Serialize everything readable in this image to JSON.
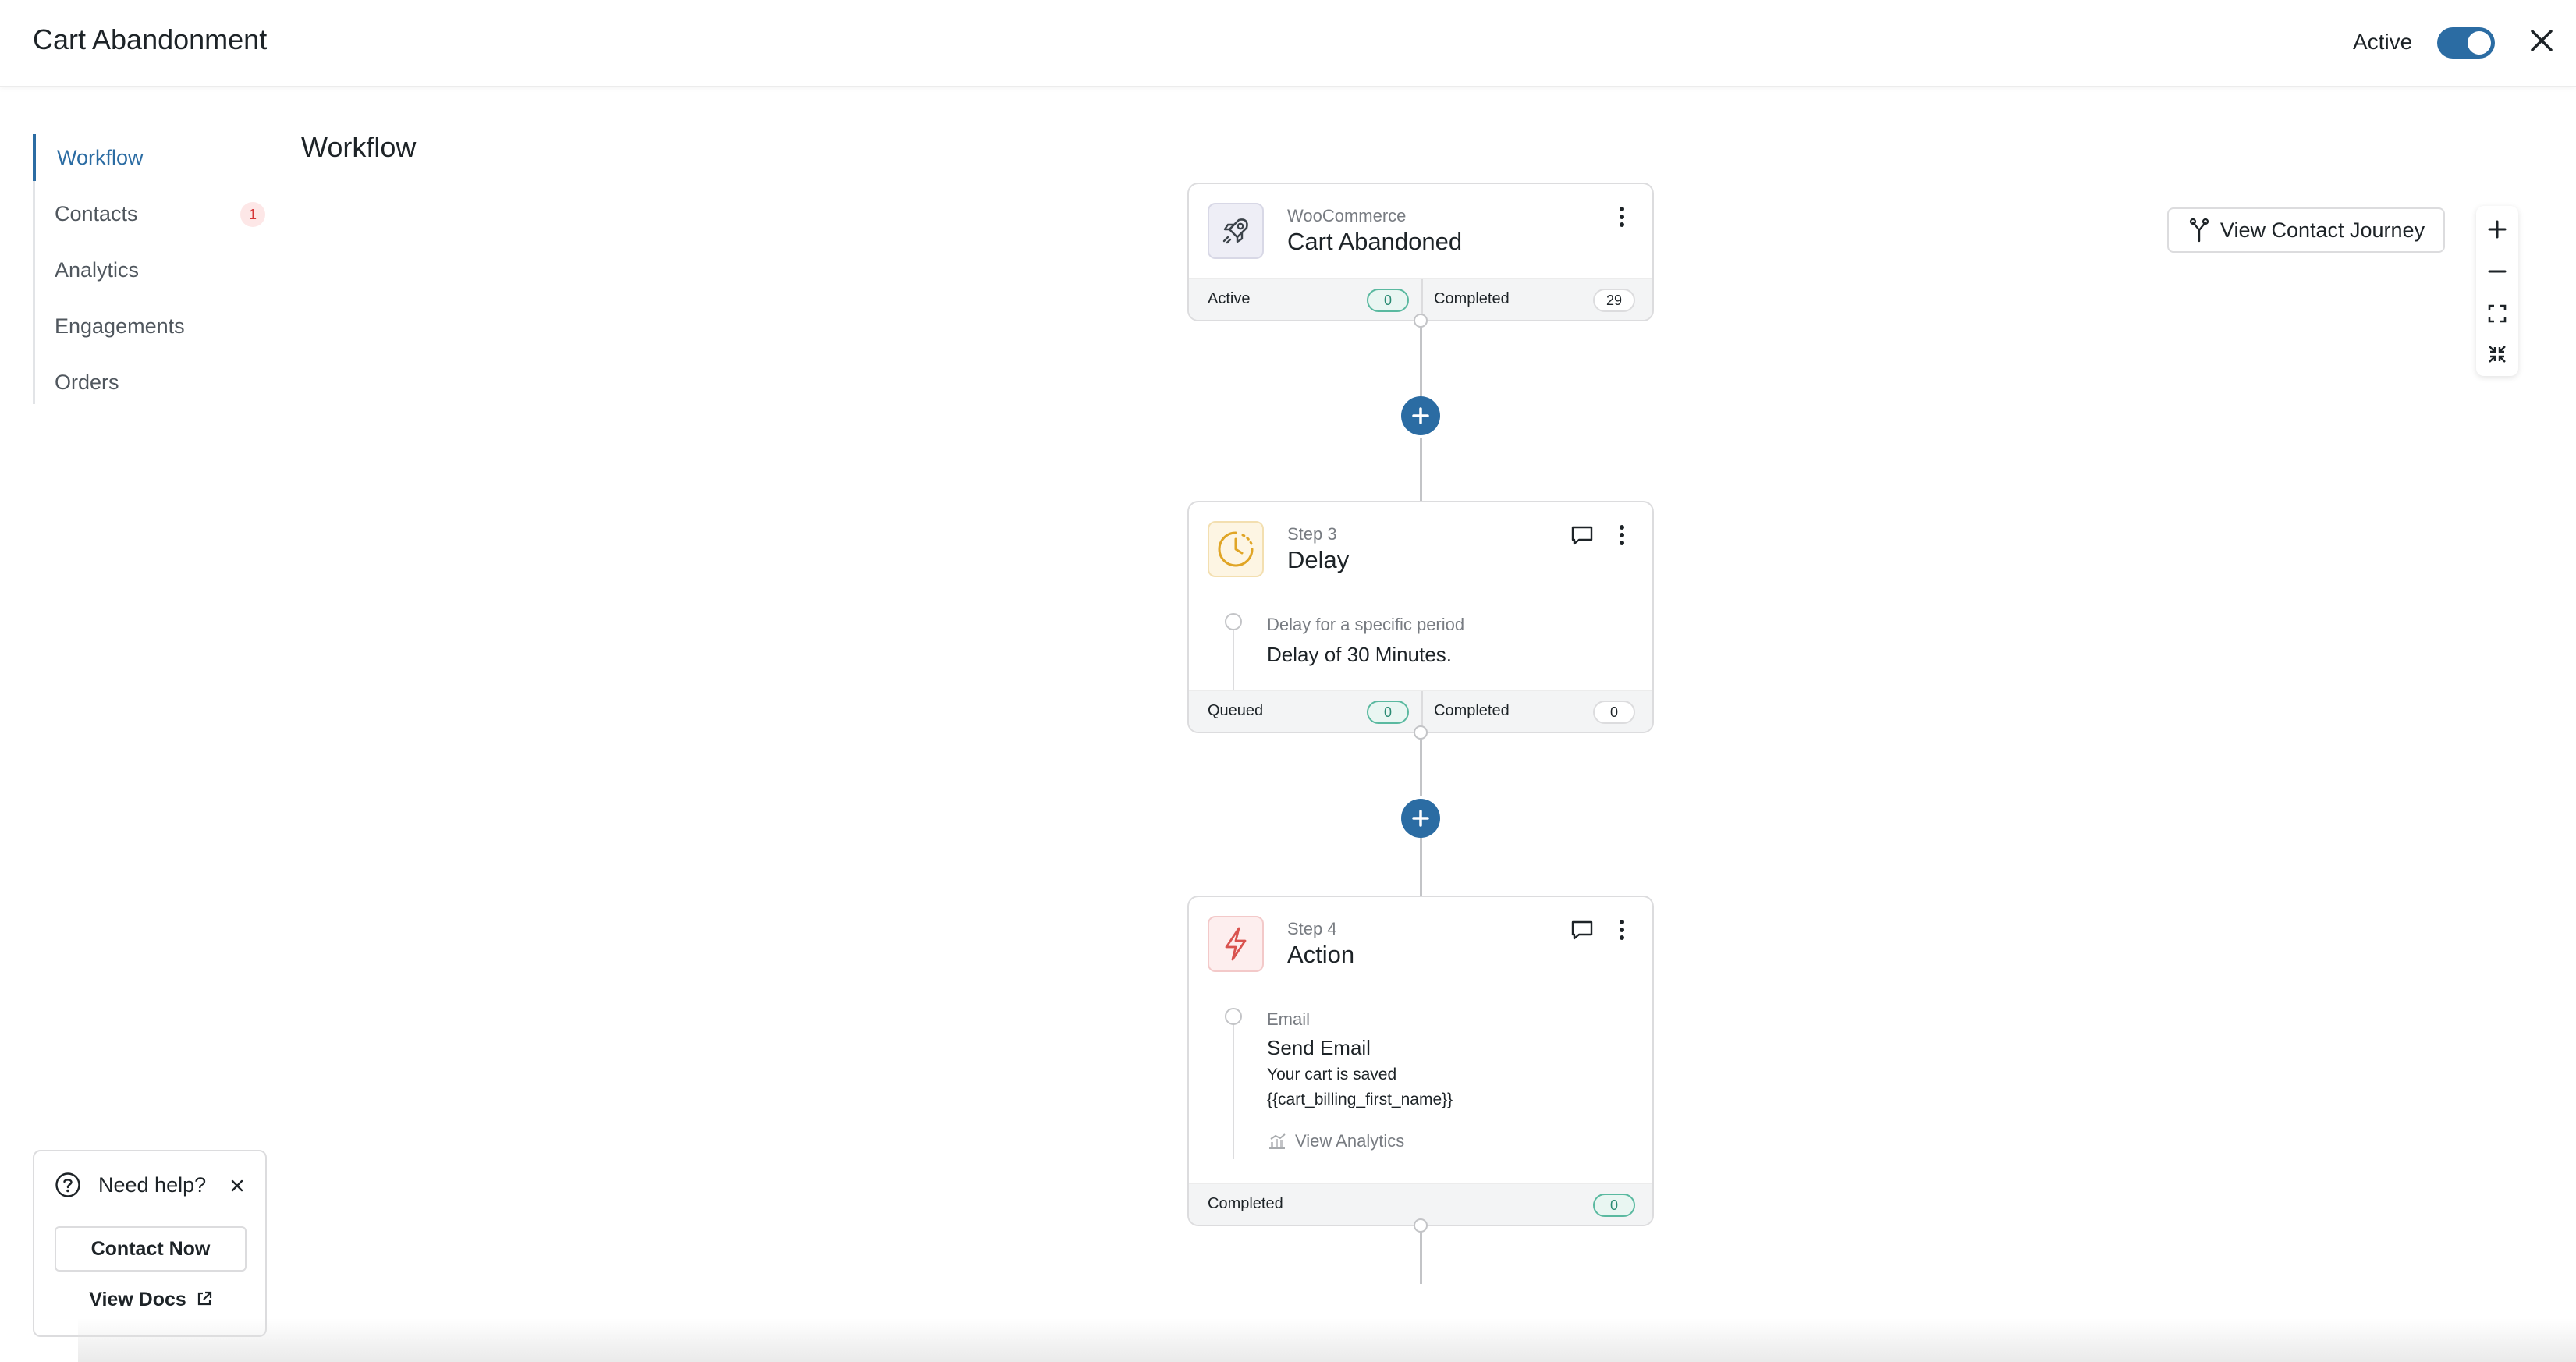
{
  "header": {
    "title": "Cart Abandonment",
    "active_label": "Active",
    "toggle_on": true
  },
  "sidebar": {
    "items": [
      {
        "label": "Workflow",
        "active": true
      },
      {
        "label": "Contacts",
        "badge": "1"
      },
      {
        "label": "Analytics"
      },
      {
        "label": "Engagements"
      },
      {
        "label": "Orders"
      }
    ]
  },
  "main": {
    "title": "Workflow"
  },
  "trigger": {
    "source": "WooCommerce",
    "title": "Cart Abandoned",
    "active_label": "Active",
    "active_count": "0",
    "completed_label": "Completed",
    "completed_count": "29"
  },
  "delay": {
    "step": "Step 3",
    "title": "Delay",
    "desc_small": "Delay for a specific period",
    "desc_main": "Delay of 30 Minutes.",
    "queued_label": "Queued",
    "queued_count": "0",
    "completed_label": "Completed",
    "completed_count": "0"
  },
  "action": {
    "step": "Step 4",
    "title": "Action",
    "type": "Email",
    "name": "Send Email",
    "subject_line1": "Your cart is saved",
    "subject_line2": "{{cart_billing_first_name}}",
    "analytics_link": "View Analytics",
    "completed_label": "Completed",
    "completed_count": "0"
  },
  "tools": {
    "journey_label": "View Contact Journey"
  },
  "help": {
    "title": "Need help?",
    "contact_label": "Contact Now",
    "docs_label": "View Docs"
  },
  "colors": {
    "accent": "#2b6ca3",
    "badge_red": "#d63638",
    "pill_green": "#2a8b73"
  }
}
